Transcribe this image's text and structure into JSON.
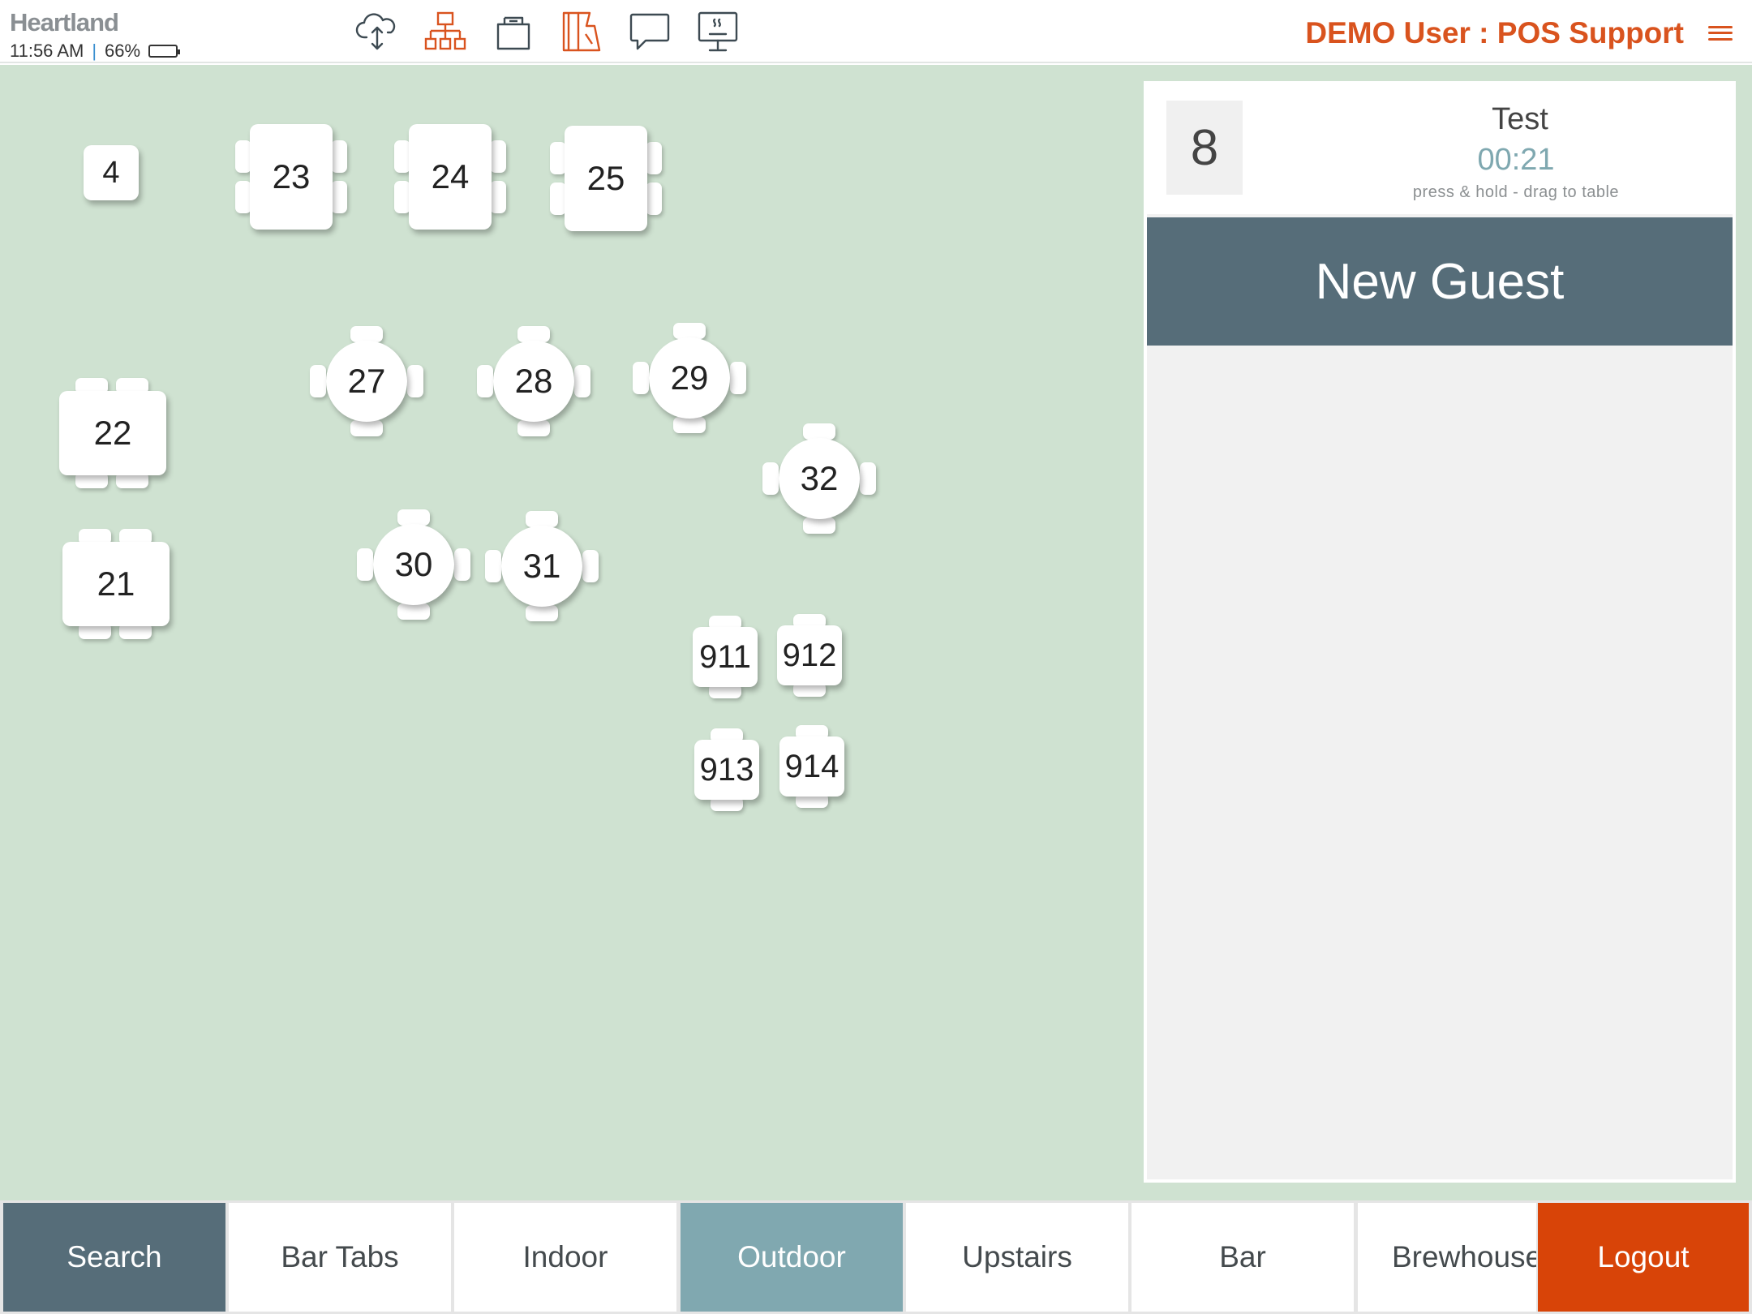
{
  "header": {
    "brand": "Heartland",
    "time": "11:56 AM",
    "separator": "|",
    "battery": "66%",
    "battery_level": 0.66,
    "user": "DEMO User : POS Support"
  },
  "toolbar": {
    "icons": [
      "cloud-sync-icon",
      "org-chart-icon",
      "drawer-icon",
      "server-book-icon",
      "chat-icon",
      "kitchen-display-icon"
    ]
  },
  "tables": [
    {
      "id": "4",
      "label": "4"
    },
    {
      "id": "23",
      "label": "23"
    },
    {
      "id": "24",
      "label": "24"
    },
    {
      "id": "25",
      "label": "25"
    },
    {
      "id": "22",
      "label": "22"
    },
    {
      "id": "21",
      "label": "21"
    },
    {
      "id": "27",
      "label": "27"
    },
    {
      "id": "28",
      "label": "28"
    },
    {
      "id": "29",
      "label": "29"
    },
    {
      "id": "32",
      "label": "32"
    },
    {
      "id": "30",
      "label": "30"
    },
    {
      "id": "31",
      "label": "31"
    },
    {
      "id": "911",
      "label": "911"
    },
    {
      "id": "912",
      "label": "912"
    },
    {
      "id": "913",
      "label": "913"
    },
    {
      "id": "914",
      "label": "914"
    }
  ],
  "waitlist": {
    "party_size": "8",
    "name": "Test",
    "timer": "00:21",
    "hint": "press & hold - drag to table",
    "new_guest_label": "New Guest"
  },
  "tabs": {
    "search": "Search",
    "bar_tabs": "Bar Tabs",
    "indoor": "Indoor",
    "outdoor": "Outdoor",
    "upstairs": "Upstairs",
    "bar": "Bar",
    "brewhouse": "Brewhouse",
    "logout": "Logout",
    "active": "Outdoor"
  },
  "colors": {
    "accent": "#d9531e",
    "floor": "#cfe2d1",
    "slate": "#566d79",
    "active_tab": "#80a8b0",
    "logout": "#d84408"
  }
}
